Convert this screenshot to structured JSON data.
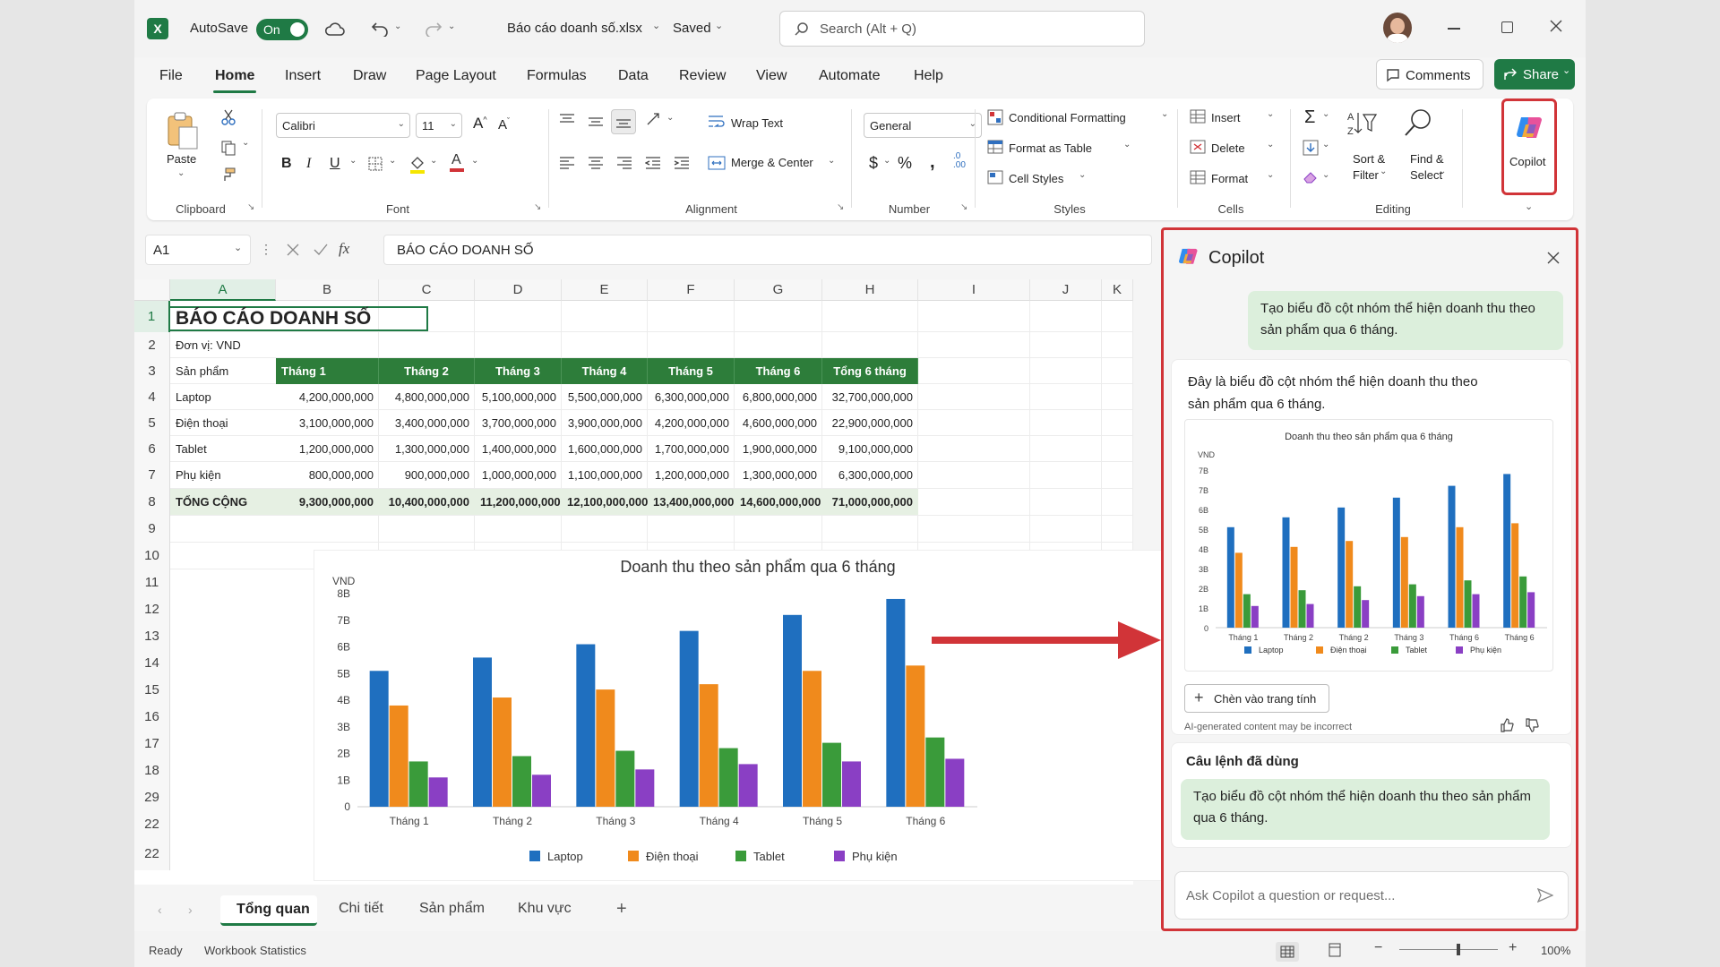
{
  "titlebar": {
    "autosave_label": "AutoSave",
    "autosave_state": "On",
    "filename": "Báo cáo doanh số.xlsx",
    "save_status": "Saved",
    "search_placeholder": "Search (Alt + Q)"
  },
  "menu": [
    "File",
    "Home",
    "Insert",
    "Draw",
    "Page Layout",
    "Formulas",
    "Data",
    "Review",
    "View",
    "Automate",
    "Help"
  ],
  "menu_active": "Home",
  "top_buttons": {
    "comments": "Comments",
    "share": "Share"
  },
  "ribbon": {
    "clipboard": {
      "paste": "Paste",
      "label": "Clipboard"
    },
    "font": {
      "name": "Calibri",
      "size": "11",
      "label": "Font"
    },
    "alignment": {
      "wrap": "Wrap Text",
      "merge": "Merge & Center",
      "label": "Alignment"
    },
    "number": {
      "format": "General",
      "label": "Number"
    },
    "styles": {
      "conditional": "Conditional Formatting",
      "format_table": "Format as Table",
      "cell_styles": "Cell Styles",
      "label": "Styles"
    },
    "cells": {
      "insert": "Insert",
      "delete": "Delete",
      "format": "Format",
      "label": "Cells"
    },
    "editing": {
      "sort1": "Sort &",
      "sort2": "Filter",
      "find1": "Find &",
      "find2": "Select",
      "label": "Editing"
    },
    "copilot": {
      "label": "Copilot"
    }
  },
  "formula_bar": {
    "name_box": "A1",
    "fx": "fx",
    "content": "BÁO CÁO DOANH SỐ"
  },
  "columns": [
    "A",
    "B",
    "C",
    "D",
    "E",
    "F",
    "G",
    "H",
    "I",
    "J",
    "K"
  ],
  "rows": [
    "1",
    "2",
    "3",
    "4",
    "5",
    "6",
    "7",
    "8",
    "9",
    "10",
    "11",
    "12",
    "13",
    "14",
    "15",
    "16",
    "17",
    "18",
    "29",
    "22",
    "22"
  ],
  "sheet": {
    "title": "BÁO CÁO DOANH SỐ",
    "unit": "Đơn vị: VND",
    "headers": [
      "Sản phẩm",
      "Tháng 1",
      "Tháng 2",
      "Tháng 3",
      "Tháng 4",
      "Tháng 5",
      "Tháng 6",
      "Tổng 6 tháng"
    ],
    "rows": [
      [
        "Laptop",
        "4,200,000,000",
        "4,800,000,000",
        "5,100,000,000",
        "5,500,000,000",
        "6,300,000,000",
        "6,800,000,000",
        "32,700,000,000"
      ],
      [
        "Điện thoại",
        "3,100,000,000",
        "3,400,000,000",
        "3,700,000,000",
        "3,900,000,000",
        "4,200,000,000",
        "4,600,000,000",
        "22,900,000,000"
      ],
      [
        "Tablet",
        "1,200,000,000",
        "1,300,000,000",
        "1,400,000,000",
        "1,600,000,000",
        "1,700,000,000",
        "1,900,000,000",
        "9,100,000,000"
      ],
      [
        "Phụ kiện",
        "800,000,000",
        "900,000,000",
        "1,000,000,000",
        "1,100,000,000",
        "1,200,000,000",
        "1,300,000,000",
        "6,300,000,000"
      ]
    ],
    "total": [
      "TỔNG CỘNG",
      "9,300,000,000",
      "10,400,000,000",
      "11,200,000,000",
      "12,100,000,000",
      "13,400,000,000",
      "14,600,000,000",
      "71,000,000,000"
    ]
  },
  "chart_data": [
    {
      "type": "bar",
      "title": "Doanh thu theo sản phẩm qua 6 tháng",
      "ylabel": "VND",
      "categories": [
        "Tháng 1",
        "Tháng 2",
        "Tháng 3",
        "Tháng 4",
        "Tháng 5",
        "Tháng 6"
      ],
      "yticks": [
        "0",
        "1B",
        "2B",
        "3B",
        "4B",
        "5B",
        "6B",
        "7B",
        "8B"
      ],
      "ylim": [
        0,
        8
      ],
      "series": [
        {
          "name": "Laptop",
          "color": "#1f6fbf",
          "values": [
            5.1,
            5.6,
            6.1,
            6.6,
            7.2,
            7.8
          ]
        },
        {
          "name": "Điện thoại",
          "color": "#f08a1c",
          "values": [
            3.8,
            4.1,
            4.4,
            4.6,
            5.1,
            5.3
          ]
        },
        {
          "name": "Tablet",
          "color": "#3a9b3a",
          "values": [
            1.7,
            1.9,
            2.1,
            2.2,
            2.4,
            2.6
          ]
        },
        {
          "name": "Phụ kiện",
          "color": "#8a3fc4",
          "values": [
            1.1,
            1.2,
            1.4,
            1.6,
            1.7,
            1.8
          ]
        }
      ],
      "legend": "bottom"
    },
    {
      "type": "bar",
      "title": "Doanh thu theo sản phẩm qua 6 tháng",
      "ylabel": "VND",
      "categories": [
        "Tháng 1",
        "Tháng 2",
        "Tháng 2",
        "Tháng 3",
        "Tháng 6",
        "Tháng 6"
      ],
      "yticks": [
        "0",
        "1B",
        "2B",
        "3B",
        "4B",
        "5B",
        "6B",
        "7B",
        "7B"
      ],
      "ylim": [
        0,
        8
      ],
      "series": [
        {
          "name": "Laptop",
          "color": "#1f6fbf",
          "values": [
            5.1,
            5.6,
            6.1,
            6.6,
            7.2,
            7.8
          ]
        },
        {
          "name": "Điện thoại",
          "color": "#f08a1c",
          "values": [
            3.8,
            4.1,
            4.4,
            4.6,
            5.1,
            5.3
          ]
        },
        {
          "name": "Tablet",
          "color": "#3a9b3a",
          "values": [
            1.7,
            1.9,
            2.1,
            2.2,
            2.4,
            2.6
          ]
        },
        {
          "name": "Phụ kiện",
          "color": "#8a3fc4",
          "values": [
            1.1,
            1.2,
            1.4,
            1.6,
            1.7,
            1.8
          ]
        }
      ],
      "legend": "bottom"
    }
  ],
  "copilot": {
    "title": "Copilot",
    "user_prompt": "Tạo biểu đồ cột nhóm thể hiện doanh thu theo sản phẩm qua 6 tháng.",
    "reply": "Đây là biểu đồ cột nhóm thể hiện doanh thu theo sản phẩm qua 6 tháng.",
    "insert_button": "Chèn vào trang tính",
    "disclaimer": "AI-generated content may be incorrect",
    "used_prompts_title": "Câu lệnh đã dùng",
    "used_prompt": "Tạo biểu đồ cột nhóm thể hiện doanh thu theo sản phẩm qua 6 tháng.",
    "input_placeholder": "Ask Copilot a question or request..."
  },
  "sheet_tabs": [
    "Tổng quan",
    "Chi tiết",
    "Sản phẩm",
    "Khu vực"
  ],
  "status": {
    "ready": "Ready",
    "stats": "Workbook Statistics",
    "zoom": "100%"
  },
  "accent": "#1f7a45",
  "highlight": "#d13438"
}
